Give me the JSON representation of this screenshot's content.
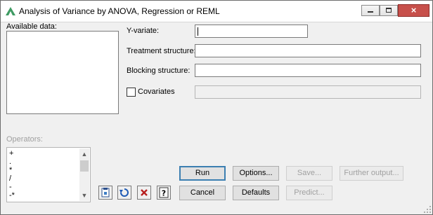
{
  "window": {
    "title": "Analysis of Variance by ANOVA, Regression or REML",
    "minimize": "minimize-icon",
    "maximize": "maximize-icon",
    "close": "×"
  },
  "available_data": {
    "label": "Available data:"
  },
  "fields": {
    "y_variate": {
      "label": "Y-variate:",
      "value": ""
    },
    "treatment": {
      "label": "Treatment structure:",
      "value": ""
    },
    "blocking": {
      "label": "Blocking structure:",
      "value": ""
    },
    "covariates": {
      "label": "Covariates",
      "checked": false,
      "value": ""
    }
  },
  "operators": {
    "label": "Operators:",
    "items": [
      "+",
      ".",
      "*",
      "/",
      "-",
      "-*"
    ]
  },
  "buttons": {
    "run": "Run",
    "options": "Options...",
    "save": "Save...",
    "further_output": "Further output...",
    "cancel": "Cancel",
    "defaults": "Defaults",
    "predict": "Predict..."
  },
  "icons": [
    "clipboard-icon",
    "undo-icon",
    "clear-icon",
    "help-icon"
  ],
  "colors": {
    "accent": "#3c7fb1",
    "close_button": "#c7504b"
  }
}
